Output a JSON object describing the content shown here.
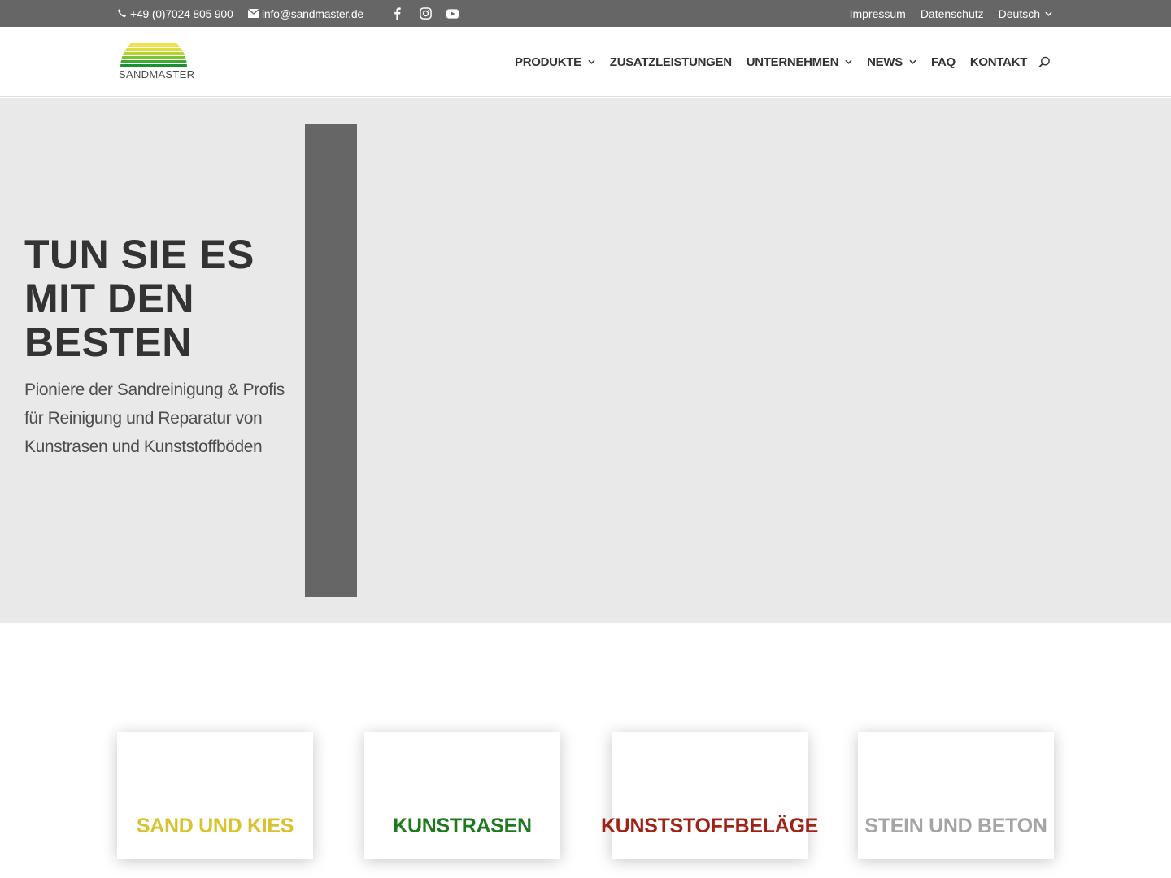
{
  "topbar": {
    "phone": "+49 (0)7024 805 900",
    "email": "info@sandmaster.de",
    "social": [
      "facebook-icon",
      "instagram-icon",
      "youtube-icon"
    ],
    "links": {
      "impressum": "Impressum",
      "datenschutz": "Datenschutz",
      "language": "Deutsch"
    }
  },
  "header": {
    "logo_text": "SANDMASTER",
    "nav": {
      "produkte": "PRODUKTE",
      "zusatzleistungen": "ZUSATZLEISTUNGEN",
      "unternehmen": "UNTERNEHMEN",
      "news": "NEWS",
      "faq": "FAQ",
      "kontakt": "KONTAKT"
    }
  },
  "hero": {
    "title_line1": "TUN SIE ES",
    "title_line2": "MIT DEN",
    "title_line3": "BESTEN",
    "subtitle": "Pioniere der Sandreinigung & Profis für Reinigung und Reparatur von Kunstrasen und Kunststoffböden"
  },
  "cards": [
    {
      "label": "SAND UND KIES",
      "color": "#d9c22e"
    },
    {
      "label": "KUNSTRASEN",
      "color": "#1f7a1f"
    },
    {
      "label": "KUNSTSTOFFBELÄGE",
      "color": "#a02318"
    },
    {
      "label": "STEIN UND BETON",
      "color": "#a5a5a5"
    }
  ],
  "colors": {
    "topbar": "#666666",
    "hero_bg": "#e9e9e9",
    "hero_bar": "#666666"
  }
}
